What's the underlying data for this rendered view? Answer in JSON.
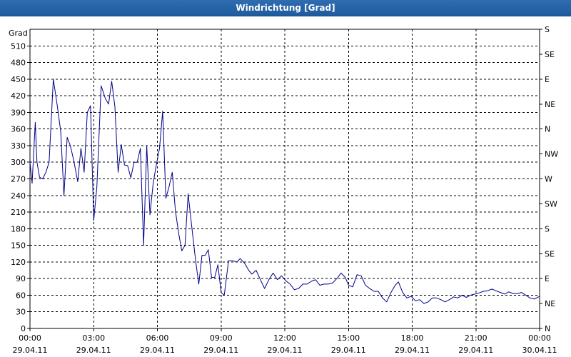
{
  "window": {
    "title": "Windrichtung [Grad]"
  },
  "chart_data": {
    "type": "line",
    "title": "Windrichtung [Grad]",
    "ylabel": "Grad",
    "xlabel": "",
    "ylim": [
      0,
      540
    ],
    "xlim_hours": [
      0,
      24
    ],
    "grid": true,
    "y_ticks": [
      0,
      30,
      60,
      90,
      120,
      150,
      180,
      210,
      240,
      270,
      300,
      330,
      360,
      390,
      420,
      450,
      480,
      510
    ],
    "y2_ticks": [
      {
        "value": 0,
        "label": "N"
      },
      {
        "value": 45,
        "label": "NE"
      },
      {
        "value": 90,
        "label": "E"
      },
      {
        "value": 135,
        "label": "SE"
      },
      {
        "value": 180,
        "label": "S"
      },
      {
        "value": 225,
        "label": "SW"
      },
      {
        "value": 270,
        "label": "W"
      },
      {
        "value": 315,
        "label": "NW"
      },
      {
        "value": 360,
        "label": "N"
      },
      {
        "value": 405,
        "label": "NE"
      },
      {
        "value": 450,
        "label": "E"
      },
      {
        "value": 495,
        "label": "SE"
      },
      {
        "value": 540,
        "label": "S"
      }
    ],
    "x_ticks": [
      {
        "hour": 0,
        "time": "00:00",
        "date": "29.04.11"
      },
      {
        "hour": 3,
        "time": "03:00",
        "date": "29.04.11"
      },
      {
        "hour": 6,
        "time": "06:00",
        "date": "29.04.11"
      },
      {
        "hour": 9,
        "time": "09:00",
        "date": "29.04.11"
      },
      {
        "hour": 12,
        "time": "12:00",
        "date": "29.04.11"
      },
      {
        "hour": 15,
        "time": "15:00",
        "date": "29.04.11"
      },
      {
        "hour": 18,
        "time": "18:00",
        "date": "29.04.11"
      },
      {
        "hour": 21,
        "time": "21:00",
        "date": "29.04.11"
      },
      {
        "hour": 24,
        "time": "00:00",
        "date": "30.04.11"
      }
    ],
    "line_color": "#00008b",
    "series": [
      {
        "points": [
          [
            0.0,
            300
          ],
          [
            0.1,
            262
          ],
          [
            0.25,
            372
          ],
          [
            0.33,
            300
          ],
          [
            0.45,
            273
          ],
          [
            0.6,
            270
          ],
          [
            0.75,
            282
          ],
          [
            0.9,
            300
          ],
          [
            1.1,
            450
          ],
          [
            1.3,
            398
          ],
          [
            1.45,
            355
          ],
          [
            1.6,
            240
          ],
          [
            1.75,
            345
          ],
          [
            1.9,
            330
          ],
          [
            2.05,
            305
          ],
          [
            2.25,
            265
          ],
          [
            2.4,
            325
          ],
          [
            2.55,
            282
          ],
          [
            2.7,
            390
          ],
          [
            2.85,
            402
          ],
          [
            3.0,
            195
          ],
          [
            3.15,
            255
          ],
          [
            3.35,
            438
          ],
          [
            3.55,
            415
          ],
          [
            3.7,
            405
          ],
          [
            3.85,
            446
          ],
          [
            4.0,
            400
          ],
          [
            4.15,
            282
          ],
          [
            4.3,
            332
          ],
          [
            4.45,
            295
          ],
          [
            4.6,
            294
          ],
          [
            4.75,
            272
          ],
          [
            4.9,
            300
          ],
          [
            5.05,
            300
          ],
          [
            5.2,
            325
          ],
          [
            5.35,
            150
          ],
          [
            5.5,
            330
          ],
          [
            5.65,
            205
          ],
          [
            5.8,
            262
          ],
          [
            5.95,
            295
          ],
          [
            6.1,
            325
          ],
          [
            6.25,
            392
          ],
          [
            6.4,
            235
          ],
          [
            6.55,
            256
          ],
          [
            6.7,
            282
          ],
          [
            6.85,
            212
          ],
          [
            7.0,
            172
          ],
          [
            7.15,
            140
          ],
          [
            7.3,
            150
          ],
          [
            7.45,
            243
          ],
          [
            7.6,
            190
          ],
          [
            7.8,
            122
          ],
          [
            7.95,
            80
          ],
          [
            8.1,
            132
          ],
          [
            8.25,
            132
          ],
          [
            8.4,
            142
          ],
          [
            8.55,
            92
          ],
          [
            8.7,
            92
          ],
          [
            8.85,
            115
          ],
          [
            9.0,
            65
          ],
          [
            9.15,
            60
          ],
          [
            9.35,
            122
          ],
          [
            9.55,
            122
          ],
          [
            9.75,
            120
          ],
          [
            9.9,
            126
          ],
          [
            10.1,
            118
          ],
          [
            10.3,
            105
          ],
          [
            10.45,
            98
          ],
          [
            10.65,
            105
          ],
          [
            10.85,
            88
          ],
          [
            11.05,
            72
          ],
          [
            11.25,
            88
          ],
          [
            11.45,
            100
          ],
          [
            11.65,
            88
          ],
          [
            11.85,
            95
          ],
          [
            12.05,
            86
          ],
          [
            12.25,
            80
          ],
          [
            12.45,
            70
          ],
          [
            12.65,
            72
          ],
          [
            12.85,
            80
          ],
          [
            13.05,
            80
          ],
          [
            13.25,
            85
          ],
          [
            13.45,
            88
          ],
          [
            13.65,
            78
          ],
          [
            13.85,
            80
          ],
          [
            14.05,
            80
          ],
          [
            14.25,
            82
          ],
          [
            14.45,
            90
          ],
          [
            14.65,
            100
          ],
          [
            14.85,
            92
          ],
          [
            15.0,
            78
          ],
          [
            15.2,
            75
          ],
          [
            15.4,
            97
          ],
          [
            15.6,
            95
          ],
          [
            15.8,
            78
          ],
          [
            16.0,
            72
          ],
          [
            16.2,
            67
          ],
          [
            16.4,
            67
          ],
          [
            16.6,
            55
          ],
          [
            16.8,
            48
          ],
          [
            17.0,
            65
          ],
          [
            17.2,
            78
          ],
          [
            17.35,
            84
          ],
          [
            17.55,
            65
          ],
          [
            17.75,
            55
          ],
          [
            17.95,
            58
          ],
          [
            18.15,
            50
          ],
          [
            18.35,
            52
          ],
          [
            18.55,
            45
          ],
          [
            18.75,
            48
          ],
          [
            18.95,
            55
          ],
          [
            19.15,
            55
          ],
          [
            19.35,
            52
          ],
          [
            19.55,
            48
          ],
          [
            19.75,
            52
          ],
          [
            19.95,
            57
          ],
          [
            20.15,
            55
          ],
          [
            20.35,
            60
          ],
          [
            20.55,
            56
          ],
          [
            20.75,
            60
          ],
          [
            20.95,
            62
          ],
          [
            21.15,
            64
          ],
          [
            21.35,
            67
          ],
          [
            21.55,
            68
          ],
          [
            21.75,
            71
          ],
          [
            21.95,
            68
          ],
          [
            22.15,
            65
          ],
          [
            22.35,
            62
          ],
          [
            22.55,
            66
          ],
          [
            22.75,
            63
          ],
          [
            22.95,
            63
          ],
          [
            23.15,
            65
          ],
          [
            23.35,
            60
          ],
          [
            23.55,
            55
          ],
          [
            23.75,
            53
          ],
          [
            23.95,
            57
          ],
          [
            24.0,
            58
          ]
        ]
      }
    ]
  }
}
